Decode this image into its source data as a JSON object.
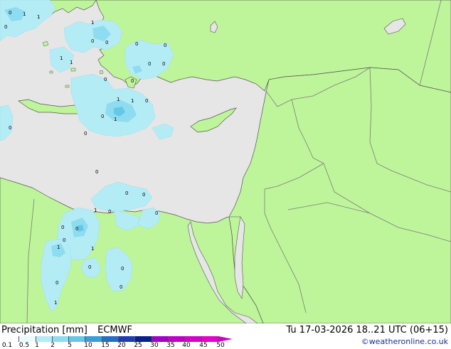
{
  "title": "Precipitation [mm]",
  "model": "ECMWF",
  "valid_time": "Tu 17-03-2026 18..21 UTC (06+15)",
  "credit": "©weatheronline.co.uk",
  "colors": {
    "sea": "#e6e6e6",
    "land": "#bff59a",
    "border": "#7a7a7a",
    "coast": "#555555",
    "precip_light": "#b4ecf6",
    "precip_mid": "#8edcf0",
    "precip_heavy": "#64c8e6"
  },
  "legend": {
    "labels": [
      "0.1",
      "0.5",
      "1",
      "2",
      "5",
      "10",
      "15",
      "20",
      "25",
      "30",
      "35",
      "40",
      "45",
      "50"
    ],
    "colors": [
      "#ffffff",
      "#e8fbff",
      "#b4ecf6",
      "#8edcf0",
      "#64c8e6",
      "#3a9ed6",
      "#2a6bc4",
      "#1e3cb0",
      "#0a1f8e",
      "#a000c8",
      "#c000c8",
      "#d400c8",
      "#e800c8"
    ]
  },
  "map_values": [
    {
      "text": "0"
    },
    {
      "text": "1"
    },
    {
      "text": "1"
    },
    {
      "text": "0"
    },
    {
      "text": "1"
    },
    {
      "text": "0"
    },
    {
      "text": "0"
    },
    {
      "text": "0"
    },
    {
      "text": "0"
    },
    {
      "text": "0"
    },
    {
      "text": "0"
    },
    {
      "text": "1"
    },
    {
      "text": "1"
    },
    {
      "text": "0"
    },
    {
      "text": "0"
    },
    {
      "text": "0"
    },
    {
      "text": "1"
    },
    {
      "text": "1"
    },
    {
      "text": "1"
    },
    {
      "text": "0"
    },
    {
      "text": "0"
    },
    {
      "text": "0"
    },
    {
      "text": "0"
    },
    {
      "text": "0"
    },
    {
      "text": "1"
    },
    {
      "text": "0"
    },
    {
      "text": "0"
    },
    {
      "text": "0"
    },
    {
      "text": "0"
    },
    {
      "text": "1"
    },
    {
      "text": "0"
    },
    {
      "text": "0"
    },
    {
      "text": "0"
    },
    {
      "text": "0"
    },
    {
      "text": "1"
    },
    {
      "text": "0"
    },
    {
      "text": "1"
    },
    {
      "text": "0"
    }
  ]
}
